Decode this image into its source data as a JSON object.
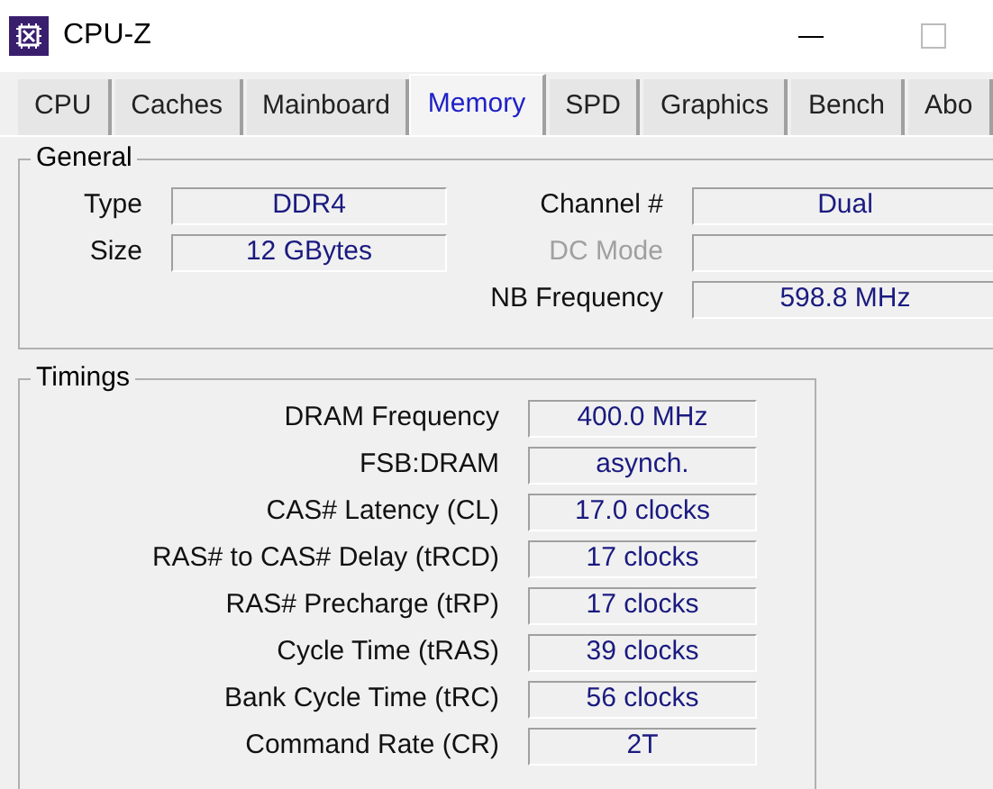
{
  "window": {
    "title": "CPU-Z"
  },
  "tabs": [
    {
      "label": "CPU",
      "selected": false
    },
    {
      "label": "Caches",
      "selected": false
    },
    {
      "label": "Mainboard",
      "selected": false
    },
    {
      "label": "Memory",
      "selected": true
    },
    {
      "label": "SPD",
      "selected": false
    },
    {
      "label": "Graphics",
      "selected": false
    },
    {
      "label": "Bench",
      "selected": false
    },
    {
      "label": "Abo",
      "selected": false
    }
  ],
  "general": {
    "title": "General",
    "left": [
      {
        "label": "Type",
        "value": "DDR4",
        "disabled": false
      },
      {
        "label": "Size",
        "value": "12 GBytes",
        "disabled": false
      }
    ],
    "right": [
      {
        "label": "Channel #",
        "value": "Dual",
        "disabled": false
      },
      {
        "label": "DC Mode",
        "disabled": true
      },
      {
        "label": "NB Frequency",
        "value": "598.8 MHz",
        "disabled": false
      }
    ]
  },
  "timings": {
    "title": "Timings",
    "rows": [
      {
        "label": "DRAM Frequency",
        "value": "400.0 MHz"
      },
      {
        "label": "FSB:DRAM",
        "value": "asynch."
      },
      {
        "label": "CAS# Latency (CL)",
        "value": "17.0 clocks"
      },
      {
        "label": "RAS# to CAS# Delay (tRCD)",
        "value": "17 clocks"
      },
      {
        "label": "RAS# Precharge (tRP)",
        "value": "17 clocks"
      },
      {
        "label": "Cycle Time (tRAS)",
        "value": "39 clocks"
      },
      {
        "label": "Bank Cycle Time (tRC)",
        "value": "56 clocks"
      },
      {
        "label": "Command Rate (CR)",
        "value": "2T"
      }
    ]
  }
}
